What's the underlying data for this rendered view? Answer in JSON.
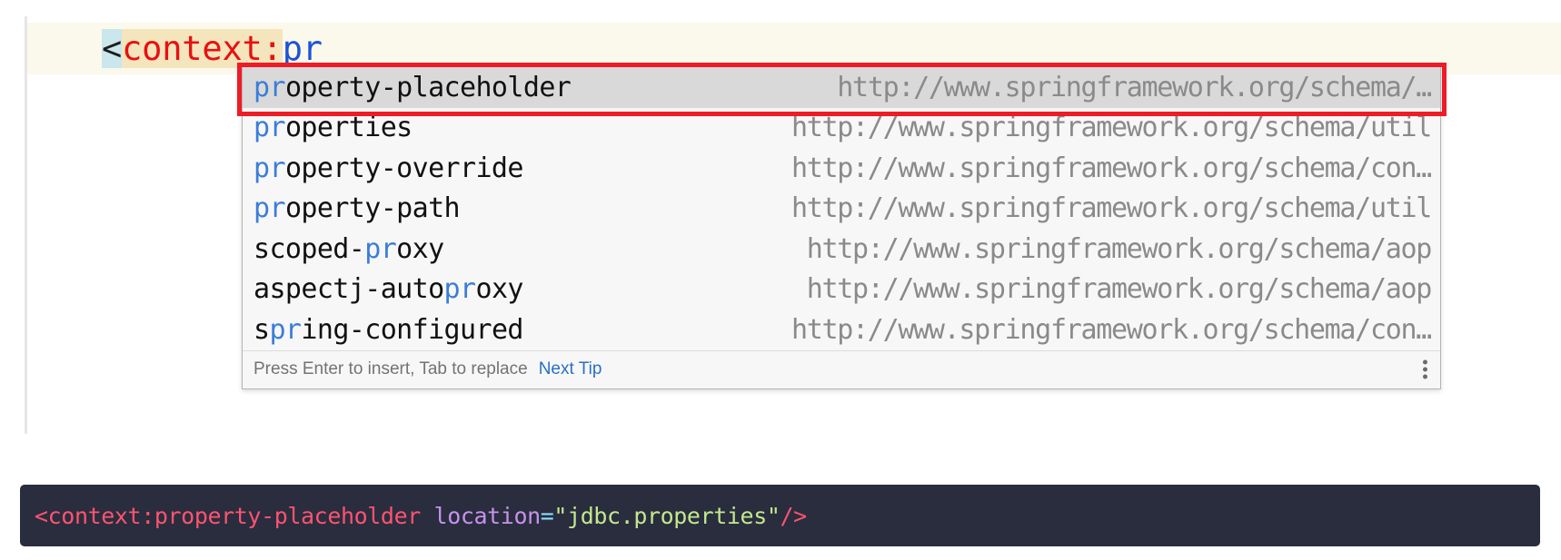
{
  "editor": {
    "line_code": {
      "bracket": "<",
      "tag_name": "context",
      "colon": ":",
      "typed": "pr"
    }
  },
  "completion": {
    "items": [
      {
        "name_pre": "",
        "name_match": "pr",
        "name_post": "operty-placeholder",
        "url": "http://www.springframework.org/schema/…",
        "selected": true
      },
      {
        "name_pre": "",
        "name_match": "pr",
        "name_post": "operties",
        "url": "http://www.springframework.org/schema/util",
        "selected": false
      },
      {
        "name_pre": "",
        "name_match": "pr",
        "name_post": "operty-override",
        "url": "http://www.springframework.org/schema/con…",
        "selected": false
      },
      {
        "name_pre": "",
        "name_match": "pr",
        "name_post": "operty-path",
        "url": "http://www.springframework.org/schema/util",
        "selected": false
      },
      {
        "name_pre": "scoped-",
        "name_match": "pr",
        "name_post": "oxy",
        "url": "http://www.springframework.org/schema/aop",
        "selected": false
      },
      {
        "name_pre": "aspectj-auto",
        "name_match": "pr",
        "name_post": "oxy",
        "url": "http://www.springframework.org/schema/aop",
        "selected": false
      },
      {
        "name_pre": "s",
        "name_match": "pr",
        "name_post": "ing-configured",
        "url": "http://www.springframework.org/schema/con…",
        "selected": false
      }
    ],
    "footer": {
      "hint": "Press Enter to insert, Tab to replace",
      "next_tip": "Next Tip",
      "kebab_icon": "more-vertical-icon"
    }
  },
  "result": {
    "tag_open": "<context:property-placeholder ",
    "attribute": "location",
    "equals": "=",
    "value": "\"jdbc.properties\"",
    "tag_close": "/>"
  },
  "colors": {
    "accent_red": "#ee1c24",
    "match_blue": "#3b7dd8",
    "tag_red": "#e81010",
    "typed_blue": "#1d52d6",
    "current_line": "#fbf8ec",
    "bracket_match": "#c9e7ec",
    "tag_highlight": "#f4e5bd",
    "selected_row": "#d9d9d9",
    "popup_bg": "#f7f7f7",
    "code_bg": "#292d3e",
    "code_tag": "#ff5370",
    "code_attr": "#c792ea",
    "code_string": "#c3e88d",
    "link_blue": "#2b6fc4"
  }
}
